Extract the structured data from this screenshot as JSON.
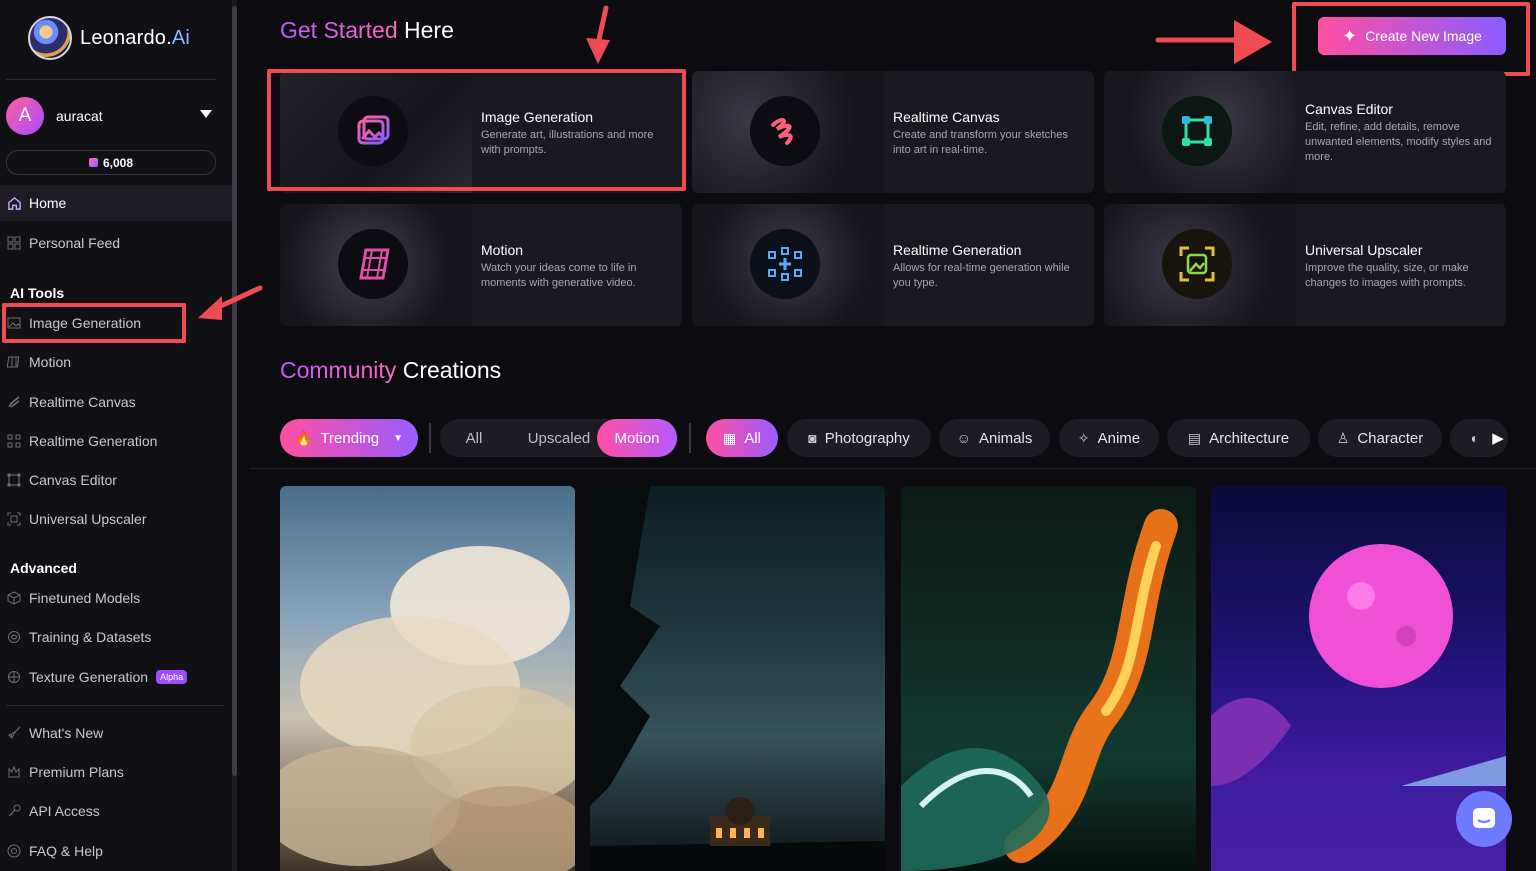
{
  "brand": {
    "name": "Leonardo.",
    "suffix": "Ai"
  },
  "user": {
    "initial": "A",
    "name": "auracat",
    "tokens": "6,008"
  },
  "sidebar": {
    "nav": [
      {
        "label": "Home"
      },
      {
        "label": "Personal Feed"
      }
    ],
    "ai_tools_title": "AI Tools",
    "ai_tools": [
      {
        "label": "Image Generation"
      },
      {
        "label": "Motion"
      },
      {
        "label": "Realtime Canvas"
      },
      {
        "label": "Realtime Generation"
      },
      {
        "label": "Canvas Editor"
      },
      {
        "label": "Universal Upscaler"
      }
    ],
    "advanced_title": "Advanced",
    "advanced": [
      {
        "label": "Finetuned Models"
      },
      {
        "label": "Training & Datasets"
      },
      {
        "label": "Texture Generation",
        "badge": "Alpha"
      }
    ],
    "footer": [
      {
        "label": "What's New"
      },
      {
        "label": "Premium Plans"
      },
      {
        "label": "API Access"
      },
      {
        "label": "FAQ & Help"
      }
    ]
  },
  "get_started": {
    "title_highlight": "Get Started",
    "title_rest": " Here"
  },
  "create_button": {
    "label": "Create New Image"
  },
  "tools": [
    {
      "name": "Image Generation",
      "desc": "Generate art, illustrations and more with prompts."
    },
    {
      "name": "Realtime Canvas",
      "desc": "Create and transform your sketches into art in real-time."
    },
    {
      "name": "Canvas Editor",
      "desc": "Edit, refine, add details, remove unwanted elements, modify styles and more."
    },
    {
      "name": "Motion",
      "desc": "Watch your ideas come to life in moments with generative video."
    },
    {
      "name": "Realtime Generation",
      "desc": "Allows for real-time generation while you type."
    },
    {
      "name": "Universal Upscaler",
      "desc": "Improve the quality, size, or make changes to images with prompts."
    }
  ],
  "community": {
    "title_highlight": "Community",
    "title_rest": " Creations"
  },
  "filters": {
    "sort": "Trending",
    "types": [
      "All",
      "Upscaled",
      "Motion"
    ],
    "active_type": "Motion",
    "categories": [
      "All",
      "Photography",
      "Animals",
      "Anime",
      "Architecture",
      "Character"
    ],
    "active_category": "All"
  },
  "colors": {
    "accent_pink": "#ff4fa3",
    "accent_purple": "#9b5cff",
    "annotation_red": "#ee4c52"
  }
}
